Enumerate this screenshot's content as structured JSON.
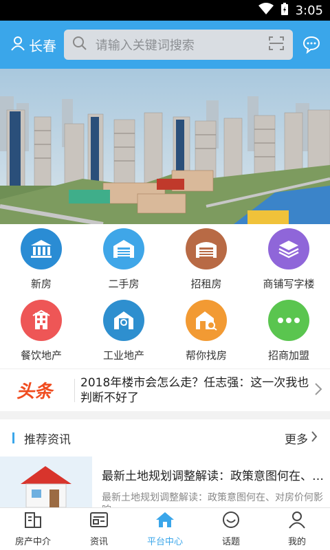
{
  "status": {
    "time": "3:05"
  },
  "header": {
    "city": "长春",
    "search_placeholder": "请输入关键词搜索"
  },
  "categories": [
    {
      "label": "新房",
      "color": "#2a8cd4",
      "icon": "bank-icon"
    },
    {
      "label": "二手房",
      "color": "#3fa6e8",
      "icon": "garage-icon"
    },
    {
      "label": "招租房",
      "color": "#b86a45",
      "icon": "store-icon"
    },
    {
      "label": "商铺写字楼",
      "color": "#8f66d9",
      "icon": "layers-icon"
    },
    {
      "label": "餐饮地产",
      "color": "#ee5656",
      "icon": "building-icon"
    },
    {
      "label": "工业地产",
      "color": "#2e8fcf",
      "icon": "factory-icon"
    },
    {
      "label": "帮你找房",
      "color": "#f29a33",
      "icon": "house-search-icon"
    },
    {
      "label": "招商加盟",
      "color": "#5ac54f",
      "icon": "more-icon"
    }
  ],
  "headline": {
    "tag": "头条",
    "text": "2018年楼市会怎么走？任志强：这一次我也判断不好了"
  },
  "recommend": {
    "title": "推荐资讯",
    "more": "更多",
    "items": [
      {
        "title": "最新土地规划调整解读：政策意图何在、对房价何影响",
        "desc": "最新土地规划调整解读：政策意图何在、对房价何影响"
      }
    ]
  },
  "tabs": [
    {
      "label": "房产中介",
      "active": false
    },
    {
      "label": "资讯",
      "active": false
    },
    {
      "label": "平台中心",
      "active": true
    },
    {
      "label": "话题",
      "active": false
    },
    {
      "label": "我的",
      "active": false
    }
  ]
}
